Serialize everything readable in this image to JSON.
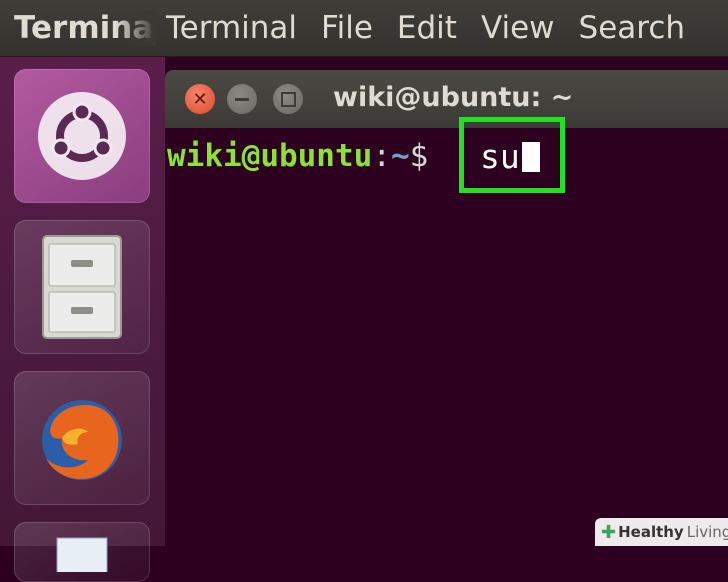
{
  "menubar": {
    "app_name": "Terminal",
    "items": [
      "Terminal",
      "File",
      "Edit",
      "View",
      "Search"
    ]
  },
  "launcher": {
    "items": [
      {
        "icon": "ubuntu-dash-icon"
      },
      {
        "icon": "files-cabinet-icon"
      },
      {
        "icon": "firefox-icon"
      },
      {
        "icon": "document-icon"
      }
    ]
  },
  "terminal": {
    "title": "wiki@ubuntu: ~",
    "prompt_user": "wiki@ubuntu",
    "prompt_sep": ":",
    "prompt_path": "~",
    "prompt_symbol": "$",
    "command": "su"
  },
  "watermark": {
    "plus": "✚",
    "brand_bold": "Healthy",
    "brand_light": "Living"
  },
  "colors": {
    "highlight": "#22e022",
    "terminal_bg": "#2c001e",
    "prompt_user": "#8ae234",
    "prompt_path": "#729fcf"
  }
}
